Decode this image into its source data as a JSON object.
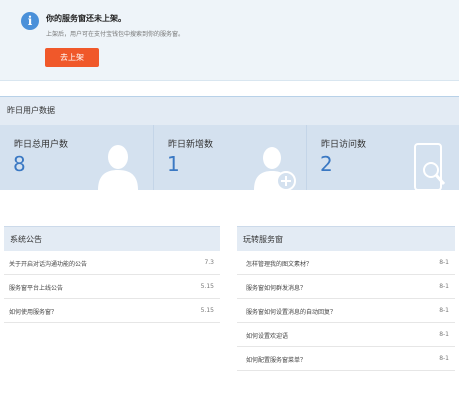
{
  "notice": {
    "title": "你的服务窗还未上架。",
    "description": "上架后，用户可在支付宝钱包中搜索到你的服务窗。",
    "button": "去上架",
    "icon": "info-icon"
  },
  "stats": {
    "header": "昨日用户数据",
    "items": [
      {
        "label": "昨日总用户数",
        "value": "8",
        "icon": "user-icon"
      },
      {
        "label": "昨日新增数",
        "value": "1",
        "icon": "user-add-icon"
      },
      {
        "label": "昨日访问数",
        "value": "2",
        "icon": "phone-search-icon"
      }
    ]
  },
  "announcements": {
    "title": "系统公告",
    "items": [
      {
        "text": "关于开启对话沟通功能的公告",
        "date": "7.3"
      },
      {
        "text": "服务窗平台上线公告",
        "date": "5.15"
      },
      {
        "text": "如何使用服务窗？",
        "date": "5.15"
      }
    ]
  },
  "guide": {
    "title": "玩转服务窗",
    "items": [
      {
        "text": "怎样管理我的图文素材？",
        "date": "8-1"
      },
      {
        "text": "服务窗如何群发消息？",
        "date": "8-1"
      },
      {
        "text": "服务窗如何设置消息的自动回复？",
        "date": "8-1"
      },
      {
        "text": "如何设置欢迎语",
        "date": "8-1"
      },
      {
        "text": "如何配置服务窗菜单？",
        "date": "8-1"
      }
    ]
  },
  "colors": {
    "accent_button": "#f0582a",
    "stat_value": "#3a78c3",
    "panel_header_bg": "#e3ebf4"
  }
}
